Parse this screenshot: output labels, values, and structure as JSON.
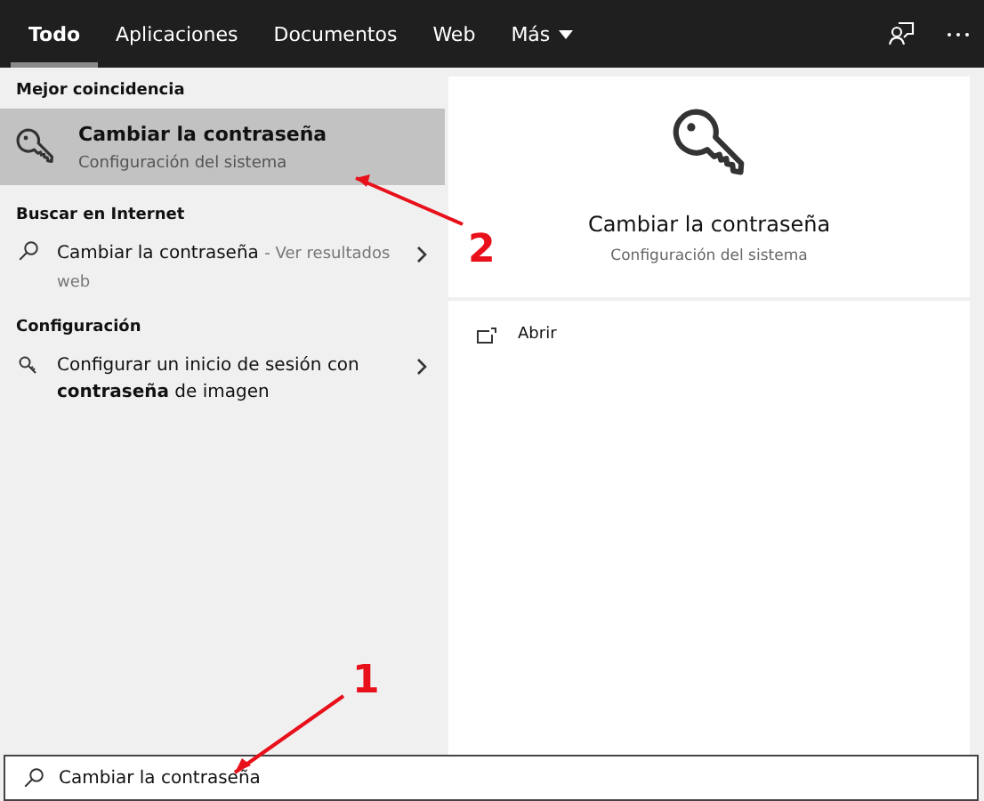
{
  "tabs": [
    {
      "label": "Todo",
      "selected": true,
      "kind": "text"
    },
    {
      "label": "Aplicaciones",
      "selected": false,
      "kind": "text"
    },
    {
      "label": "Documentos",
      "selected": false,
      "kind": "text"
    },
    {
      "label": "Web",
      "selected": false,
      "kind": "text"
    },
    {
      "label": "Más",
      "selected": false,
      "kind": "menu"
    }
  ],
  "best_match": {
    "heading": "Mejor coincidencia",
    "title": "Cambiar la contraseña",
    "subtitle": "Configuración del sistema",
    "selected": true
  },
  "sections": [
    {
      "heading": "Buscar en Internet",
      "items": [
        {
          "kind": "web",
          "title": "Cambiar la contraseña",
          "suffix": "- Ver resultados web"
        }
      ]
    },
    {
      "heading": "Configuración",
      "items": [
        {
          "kind": "setting",
          "title": "Configurar un inicio de sesión con **contraseña** de imagen"
        }
      ]
    }
  ],
  "detail": {
    "title": "Cambiar la contraseña",
    "subtitle": "Configuración del sistema",
    "actions": [
      "Abrir"
    ]
  },
  "search": {
    "value": "Cambiar la contraseña"
  },
  "annotations": [
    {
      "label": "1"
    },
    {
      "label": "2"
    }
  ]
}
